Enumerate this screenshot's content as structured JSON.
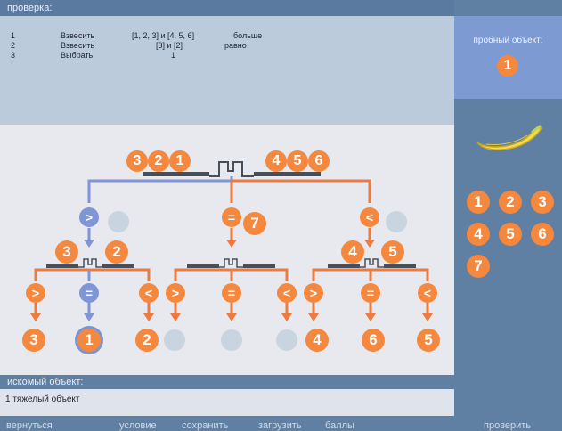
{
  "check": {
    "header": "проверка:",
    "rows": [
      {
        "n": "1",
        "action": "Взвесить",
        "arg": "[1, 2, 3] и [4, 5, 6]",
        "result": "больше"
      },
      {
        "n": "2",
        "action": "Взвесить",
        "arg": "[3] и [2]",
        "result": "равно"
      },
      {
        "n": "3",
        "action": "Выбрать",
        "arg": "1",
        "result": ""
      }
    ]
  },
  "probe": {
    "label": "пробный объект:",
    "coin": "1"
  },
  "tree": {
    "root_left": [
      "3",
      "2",
      "1"
    ],
    "root_right": [
      "4",
      "5",
      "6"
    ],
    "branch_signs": [
      ">",
      "=",
      "<"
    ],
    "middle_coin": "7",
    "left_pan": [
      "3",
      "2"
    ],
    "right_pan": [
      "4",
      "5"
    ],
    "leaf_coins": [
      "3",
      "1",
      "2",
      "4",
      "6",
      "5"
    ]
  },
  "palette": {
    "coins": [
      "1",
      "2",
      "3",
      "4",
      "5",
      "6",
      "7"
    ]
  },
  "answer": {
    "header": "искомый объект:",
    "text": "1 тяжелый объект"
  },
  "nav": {
    "back": "вернуться",
    "condition": "условие",
    "save": "сохранить",
    "load": "загрузить",
    "score": "баллы",
    "verify": "проверить"
  },
  "colors": {
    "orange": "#f5883f",
    "blue": "#7f95d6",
    "bg": "#5f7fa3"
  }
}
